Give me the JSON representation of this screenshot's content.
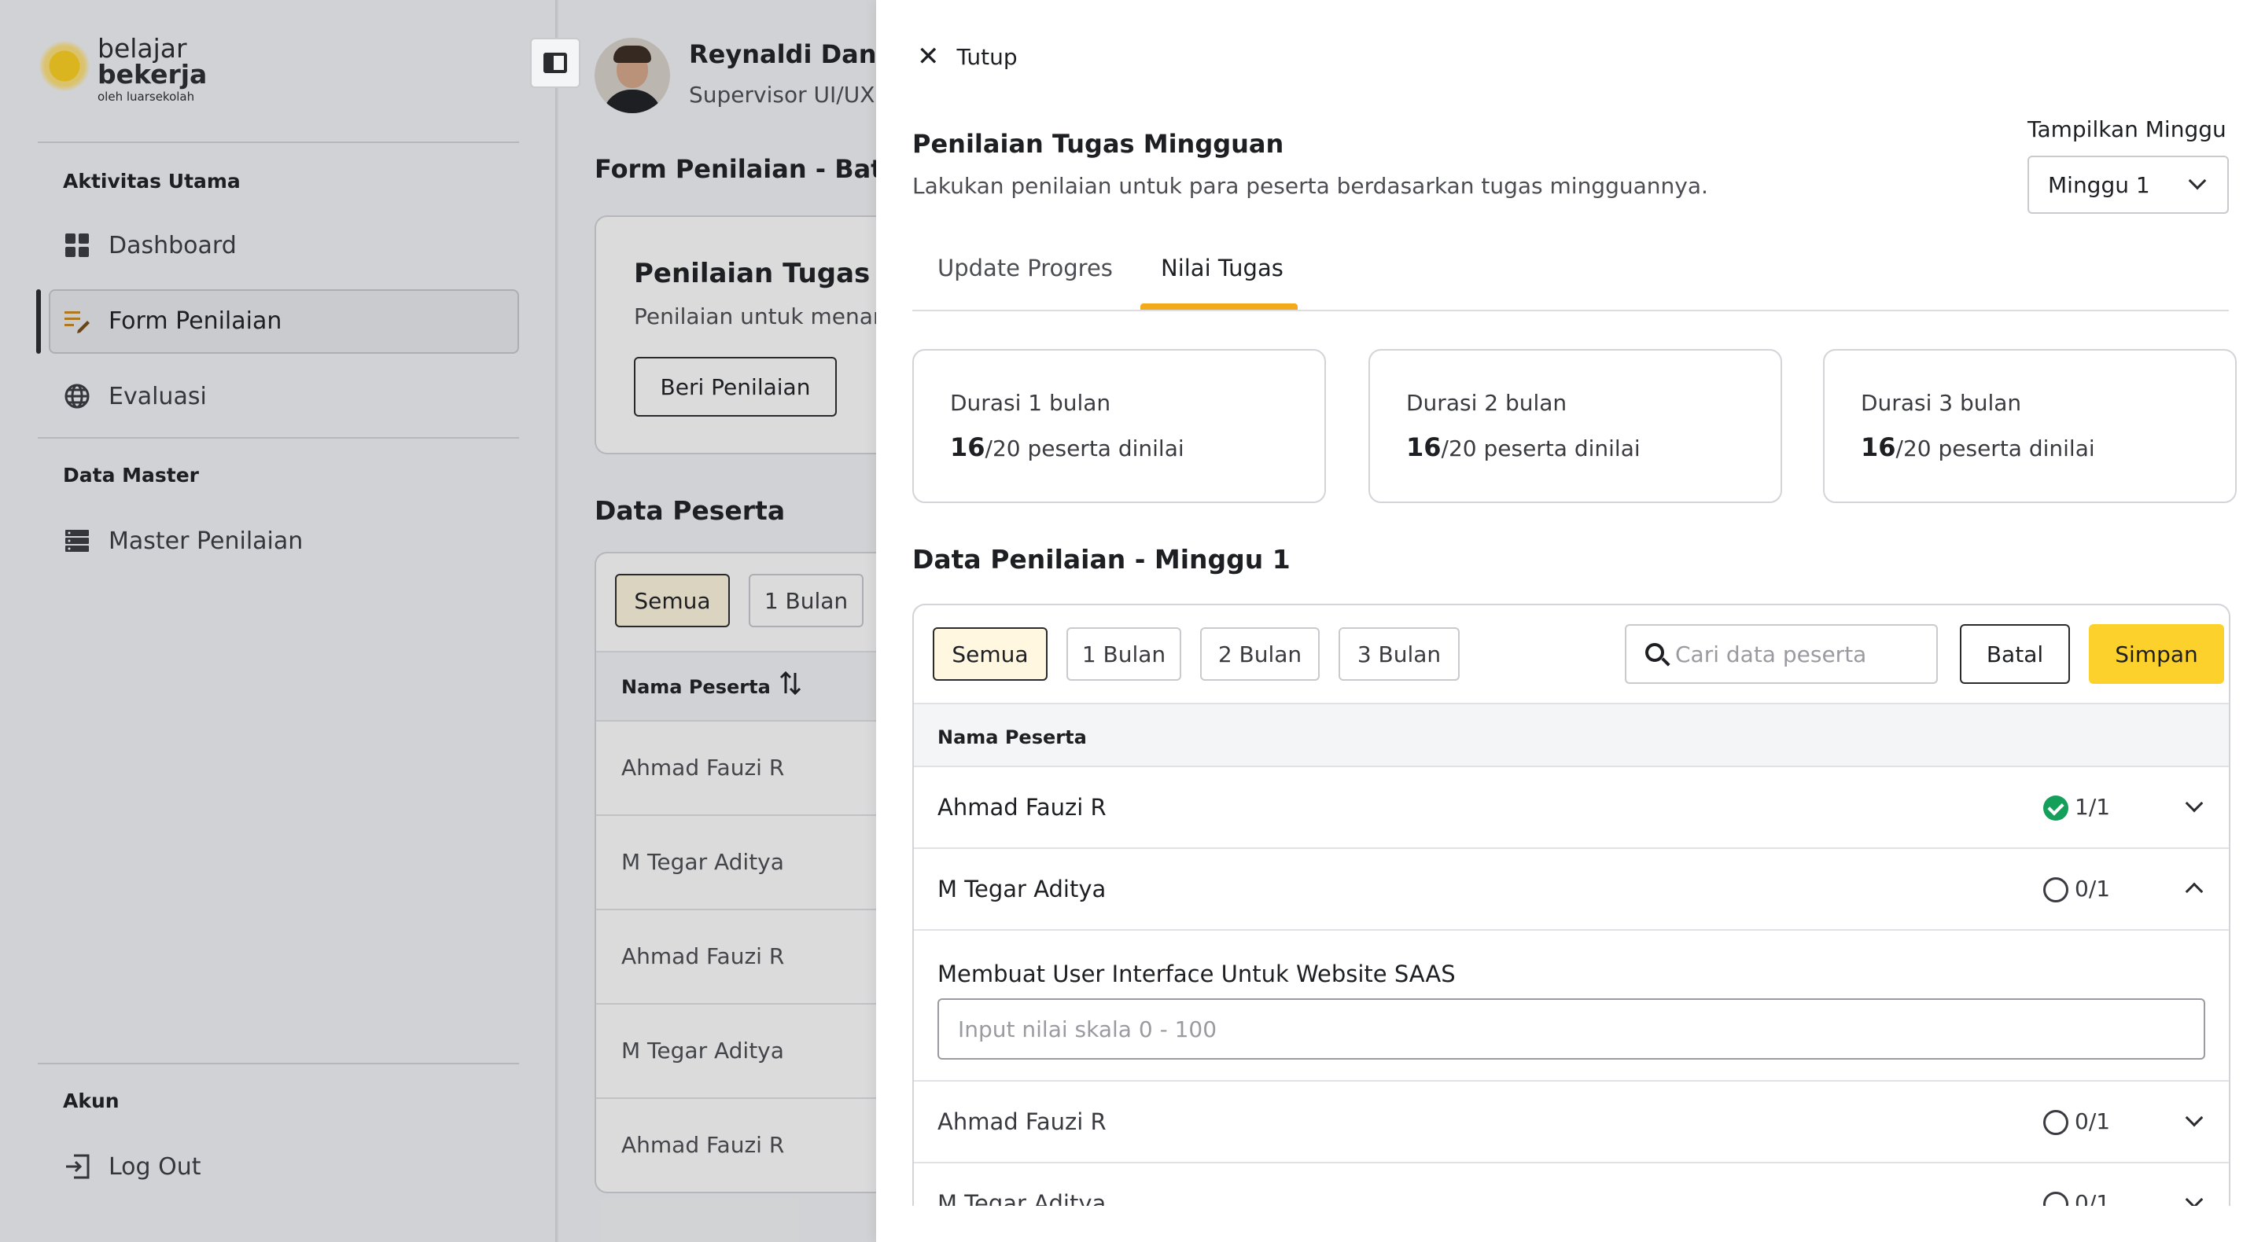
{
  "logo": {
    "line1": "belajar",
    "line2": "bekerja",
    "line3": "oleh luarsekolah"
  },
  "sidebar": {
    "sections": [
      {
        "label": "Aktivitas Utama"
      },
      {
        "label": "Data Master"
      },
      {
        "label": "Akun"
      }
    ],
    "items": [
      {
        "label": "Dashboard",
        "icon": "grid-icon"
      },
      {
        "label": "Form Penilaian",
        "icon": "edit-list-icon",
        "active": true
      },
      {
        "label": "Evaluasi",
        "icon": "globe-icon"
      },
      {
        "label": "Master Penilaian",
        "icon": "database-icon"
      }
    ],
    "logout": {
      "label": "Log Out",
      "icon": "logout-icon"
    }
  },
  "user": {
    "name": "Reynaldi Danie",
    "role": "Supervisor UI/UX"
  },
  "main": {
    "title": "Form Penilaian - Batc",
    "card": {
      "title": "Penilaian Tugas Mi",
      "subtitle": "Penilaian untuk menar",
      "button": "Beri Penilaian"
    },
    "data_title": "Data Peserta",
    "filters": [
      "Semua",
      "1 Bulan"
    ],
    "column_header": "Nama Peserta",
    "rows": [
      "Ahmad Fauzi R",
      "M Tegar Aditya",
      "Ahmad Fauzi R",
      "M Tegar Aditya",
      "Ahmad Fauzi R"
    ]
  },
  "drawer": {
    "close_label": "Tutup",
    "title": "Penilaian Tugas Mingguan",
    "subtitle": "Lakukan penilaian untuk para peserta berdasarkan tugas mingguannya.",
    "week_label": "Tampilkan Minggu",
    "week_value": "Minggu 1",
    "tabs": [
      {
        "label": "Update Progres",
        "active": false
      },
      {
        "label": "Nilai Tugas",
        "active": true
      }
    ],
    "stats": [
      {
        "label": "Durasi 1 bulan",
        "count": "16",
        "rest": "/20 peserta dinilai"
      },
      {
        "label": "Durasi 2 bulan",
        "count": "16",
        "rest": "/20 peserta dinilai"
      },
      {
        "label": "Durasi 3 bulan",
        "count": "16",
        "rest": "/20 peserta dinilai"
      }
    ],
    "table_title": "Data Penilaian - Minggu 1",
    "filters": [
      {
        "label": "Semua",
        "selected": true
      },
      {
        "label": "1 Bulan",
        "selected": false
      },
      {
        "label": "2 Bulan",
        "selected": false
      },
      {
        "label": "3 Bulan",
        "selected": false
      }
    ],
    "search_placeholder": "Cari data peserta",
    "cancel_label": "Batal",
    "save_label": "Simpan",
    "column_header": "Nama Peserta",
    "rows": [
      {
        "name": "Ahmad Fauzi R",
        "score": "1/1",
        "status": "done",
        "expanded": false
      },
      {
        "name": "M Tegar Aditya",
        "score": "0/1",
        "status": "open",
        "expanded": true
      },
      {
        "name": "Ahmad Fauzi R",
        "score": "0/1",
        "status": "open",
        "expanded": false
      },
      {
        "name": "M Tegar Aditya",
        "score": "0/1",
        "status": "open",
        "expanded": false
      }
    ],
    "expanded_task": {
      "label": "Membuat User Interface Untuk Website SAAS",
      "input_placeholder": "Input nilai skala 0 - 100"
    }
  },
  "colors": {
    "accent_yellow": "#fdd12c",
    "tab_underline": "#f2a91c",
    "success_green": "#14a05a"
  }
}
